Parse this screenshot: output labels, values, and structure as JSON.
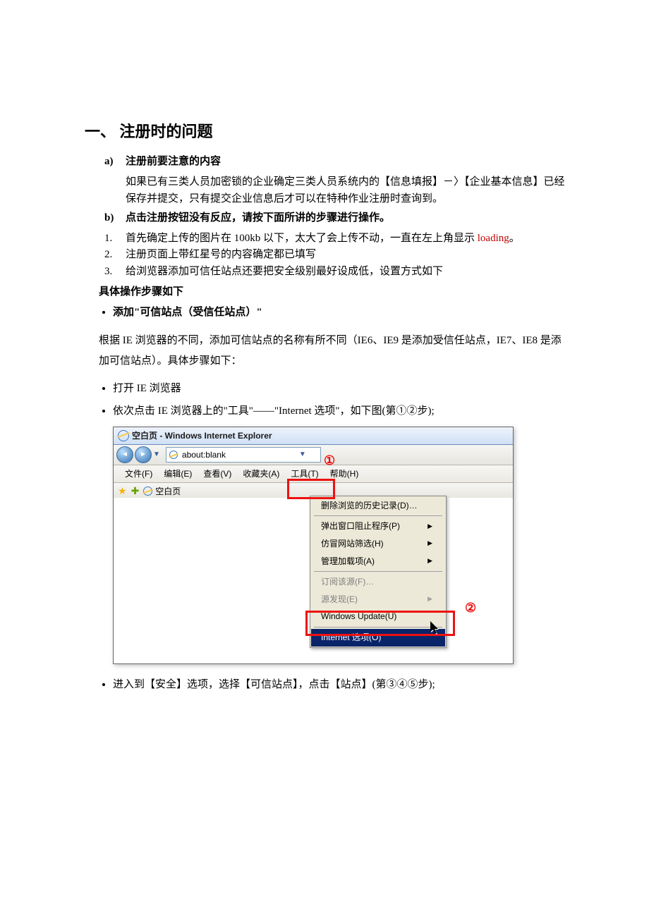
{
  "doc": {
    "h1": "一、 注册时的问题",
    "a_label": "a)",
    "a_title": "注册前要注意的内容",
    "a_body": "如果已有三类人员加密锁的企业确定三类人员系统内的【信息填报】－〉【企业基本信息】已经保存并提交，只有提交企业信息后才可以在特种作业注册时查询到。",
    "b_label": "b)",
    "b_title": "点击注册按钮没有反应，请按下面所讲的步骤进行操作。",
    "s1_n": "1.",
    "s1_pre": "首先确定上传的图片在 100kb 以下，太大了会上传不动，一直在左上角显示 ",
    "s1_red": "loading",
    "s1_post": "。",
    "s2_n": "2.",
    "s2": "注册页面上带红星号的内容确定都已填写",
    "s3_n": "3.",
    "s3": "给浏览器添加可信任站点还要把安全级别最好设成低，设置方式如下",
    "detail": "具体操作步骤如下",
    "bullet1": "添加\"可信站点（受信任站点）\"",
    "explain": "根据 IE 浏览器的不同，添加可信站点的名称有所不同（IE6、IE9 是添加受信任站点，IE7、IE8 是添加可信站点）。具体步骤如下：",
    "bullet2": "打开 IE 浏览器",
    "bullet3": "依次点击 IE 浏览器上的\"工具\"——\"Internet 选项\"，如下图(第①②步);",
    "bullet4": "进入到【安全】选项，选择【可信站点】，点击【站点】(第③④⑤步);"
  },
  "ie": {
    "title": "空白页 - Windows Internet Explorer",
    "address": "about:blank",
    "menu": {
      "file": "文件(F)",
      "edit": "编辑(E)",
      "view": "查看(V)",
      "fav": "收藏夹(A)",
      "tools": "工具(T)",
      "help": "帮助(H)"
    },
    "tab": "空白页",
    "marker1": "①",
    "marker2": "②",
    "dropdown": {
      "delete_history": "删除浏览的历史记录(D)…",
      "popup": "弹出窗口阻止程序(P)",
      "phishing": "仿冒网站筛选(H)",
      "addons": "管理加载项(A)",
      "subscribe": "订阅该源(F)…",
      "feed_discovery": "源发现(E)",
      "windows_update": "Windows Update(U)",
      "internet_options": "Internet 选项(O)"
    }
  }
}
